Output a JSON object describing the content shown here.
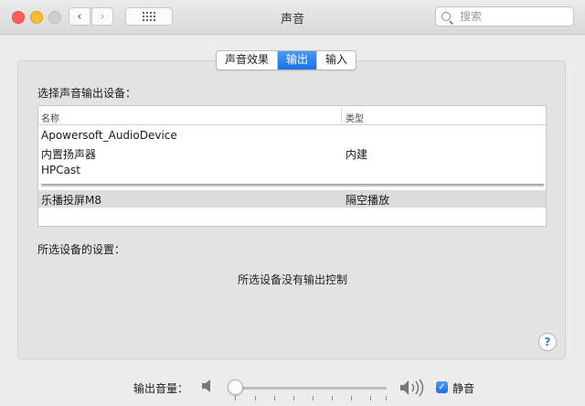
{
  "window": {
    "title": "声音",
    "back_glyph": "‹",
    "forward_glyph": "›"
  },
  "search": {
    "placeholder": "搜索"
  },
  "tabs": [
    {
      "label": "声音效果",
      "active": false
    },
    {
      "label": "输出",
      "active": true
    },
    {
      "label": "输入",
      "active": false
    }
  ],
  "output": {
    "section_title": "选择声音输出设备：",
    "columns": [
      "名称",
      "类型"
    ],
    "devices": [
      {
        "name": "Apowersoft_AudioDevice",
        "type": ""
      },
      {
        "name": "内置扬声器",
        "type": "内建"
      },
      {
        "name": "HPCast",
        "type": ""
      }
    ],
    "selected_device": {
      "name": "乐播投屏M8",
      "type": "隔空播放"
    }
  },
  "settings": {
    "section_title": "所选设备的设置：",
    "no_controls_message": "所选设备没有输出控制"
  },
  "help": {
    "label": "?"
  },
  "volume": {
    "label": "输出音量：",
    "level": 0.0,
    "mute_label": "静音",
    "muted": true,
    "mute_check_glyph": "✓"
  },
  "colors": {
    "accent": "#1a6fe9",
    "selected_row": "#dcdcdc"
  }
}
